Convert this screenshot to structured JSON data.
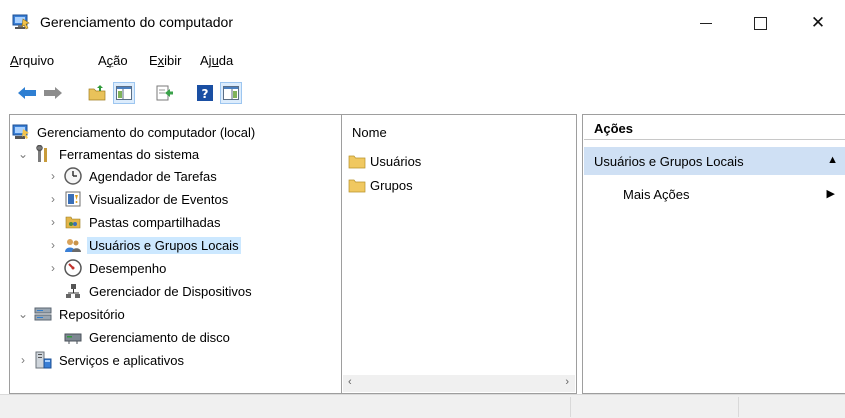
{
  "window": {
    "title": "Gerenciamento do computador",
    "minimize_glyph": "",
    "close_glyph": "✕"
  },
  "menu": {
    "items": [
      {
        "pre": "",
        "ul": "A",
        "post": "rquivo"
      },
      {
        "pre": "A",
        "ul": "ç",
        "post": "ão"
      },
      {
        "pre": "E",
        "ul": "x",
        "post": "ibir"
      },
      {
        "pre": "Aj",
        "ul": "u",
        "post": "da"
      }
    ]
  },
  "toolbar": {
    "icons": [
      "back-arrow-icon",
      "forward-arrow-icon",
      "up-folder-icon",
      "show-hide-tree-icon",
      "export-list-icon",
      "help-icon",
      "show-hide-action-pane-icon"
    ]
  },
  "tree": {
    "root": "Gerenciamento do computador (local)",
    "system_tools": "Ferramentas do sistema",
    "task_scheduler": "Agendador de Tarefas",
    "event_viewer": "Visualizador de Eventos",
    "shared_folders": "Pastas compartilhadas",
    "local_users": "Usuários e Grupos Locais",
    "performance": "Desempenho",
    "device_manager": "Gerenciador de Dispositivos",
    "storage": "Repositório",
    "disk_management": "Gerenciamento de disco",
    "services": "Serviços e aplicativos"
  },
  "list": {
    "column": "Nome",
    "items": [
      "Usuários",
      "Grupos"
    ]
  },
  "actions": {
    "header": "Ações",
    "section": "Usuários e Grupos Locais",
    "item": "Mais Ações"
  },
  "colors": {
    "selection": "#cce8ff",
    "action_section_bg": "#cfe0f4",
    "accent_blue": "#1e7bd6"
  }
}
